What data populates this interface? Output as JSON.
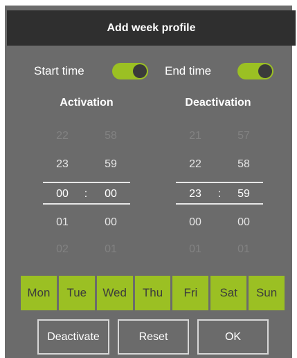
{
  "dialog": {
    "title": "Add week profile"
  },
  "toggles": {
    "start": {
      "label": "Start time",
      "on": true
    },
    "end": {
      "label": "End time",
      "on": true
    }
  },
  "activation": {
    "heading": "Activation",
    "hours": [
      "22",
      "23",
      "00",
      "01",
      "02"
    ],
    "minutes": [
      "58",
      "59",
      "00",
      "00",
      "01"
    ],
    "separator": ":"
  },
  "deactivation": {
    "heading": "Deactivation",
    "hours": [
      "21",
      "22",
      "23",
      "00",
      "01"
    ],
    "minutes": [
      "57",
      "58",
      "59",
      "00",
      "01"
    ],
    "separator": ":"
  },
  "days": [
    "Mon",
    "Tue",
    "Wed",
    "Thu",
    "Fri",
    "Sat",
    "Sun"
  ],
  "buttons": {
    "deactivate": "Deactivate",
    "reset": "Reset",
    "ok": "OK"
  },
  "colors": {
    "accent": "#9bc023",
    "dialog_bg": "#6b6b6b",
    "titlebar_bg": "#2f2f2f"
  }
}
